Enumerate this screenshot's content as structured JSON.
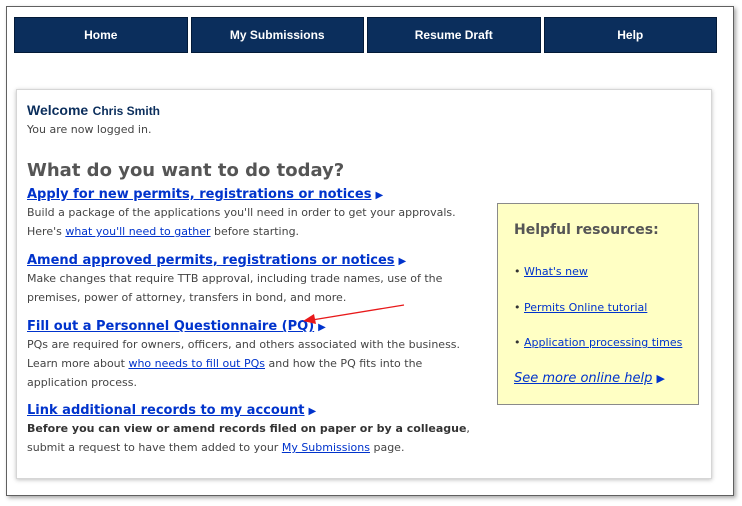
{
  "nav": {
    "items": [
      "Home",
      "My Submissions",
      "Resume Draft",
      "Help"
    ]
  },
  "welcome": {
    "prefix": "Welcome",
    "name": "Chris Smith",
    "status": "You are now logged in."
  },
  "main": {
    "heading": "What do you want to do today?",
    "sections": [
      {
        "link": "Apply for new permits, registrations or notices",
        "line1": "Build a package of the applications you'll need in order to get your approvals.",
        "line2_before": "Here's ",
        "line2_link": "what you'll need to gather",
        "line2_after": " before starting."
      },
      {
        "link": "Amend approved permits, registrations or notices",
        "line1": "Make changes that require TTB approval, including trade names, use of the",
        "line2": "premises, power of attorney, transfers in bond, and more."
      },
      {
        "link": "Fill out a Personnel Questionnaire (PQ)",
        "line1": "PQs are required for owners, officers, and others associated with the business.",
        "line2_before": "Learn more about ",
        "line2_link": "who needs to fill out PQs",
        "line2_after": " and how the PQ fits into the",
        "line3": "application process."
      },
      {
        "link": "Link additional records to my account",
        "line1_bold": "Before you can view or amend records filed on paper or by a colleague",
        "line1_after": ",",
        "line2_before": "submit a request to have them added to your ",
        "line2_link": "My Submissions",
        "line2_after": " page."
      }
    ]
  },
  "helpful": {
    "title": "Helpful resources:",
    "items": [
      "What's new",
      "Permits Online tutorial",
      "Application processing times"
    ],
    "more": "See more online help"
  },
  "colors": {
    "nav_bg": "#0b2e5c",
    "link": "#0033cc",
    "help_bg": "#ffffc4",
    "annotation_arrow": "#e8191a"
  }
}
